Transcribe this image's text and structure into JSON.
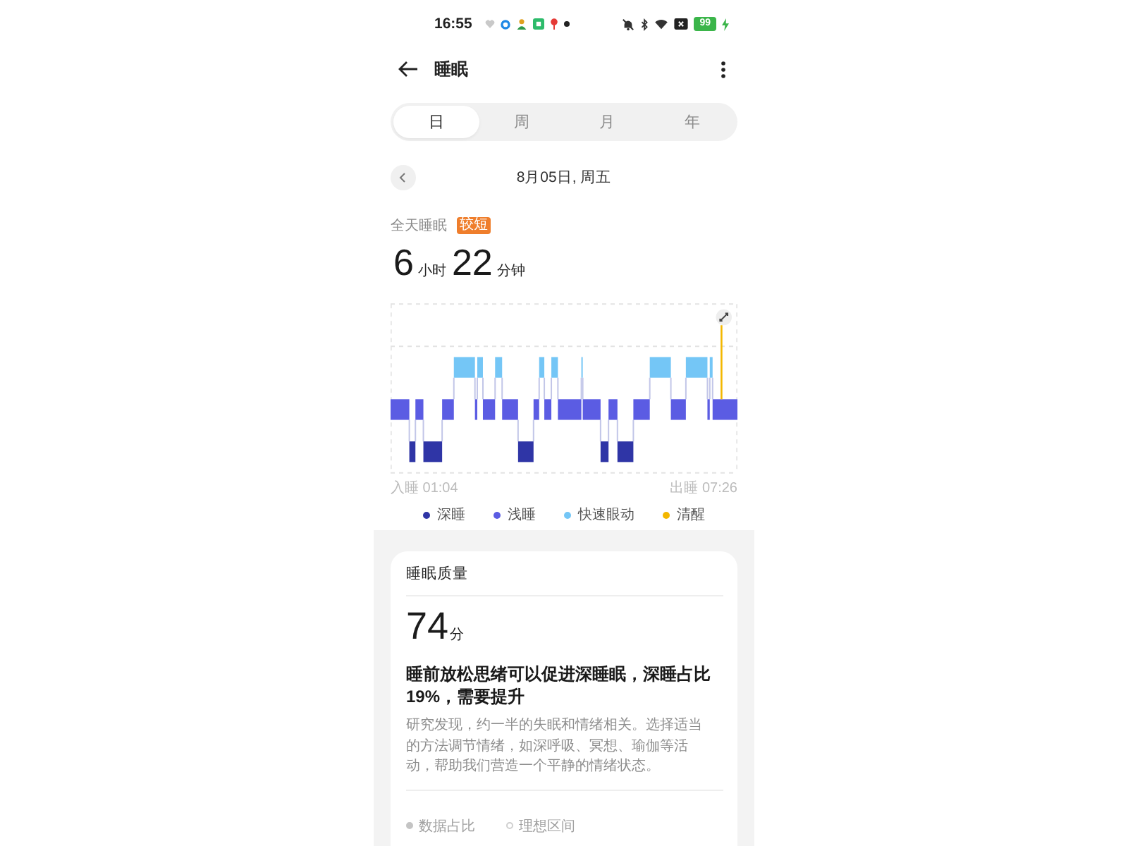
{
  "status_bar": {
    "time": "16:55",
    "battery": "99"
  },
  "header": {
    "title": "睡眠"
  },
  "period_tabs": [
    {
      "label": "日",
      "selected": true
    },
    {
      "label": "周",
      "selected": false
    },
    {
      "label": "月",
      "selected": false
    },
    {
      "label": "年",
      "selected": false
    }
  ],
  "date_nav": {
    "date": "8月05日, 周五"
  },
  "summary": {
    "label": "全天睡眠",
    "badge": "较短",
    "duration": [
      {
        "value": "6",
        "unit": "小时"
      },
      {
        "value": "22",
        "unit": "分钟"
      }
    ]
  },
  "chart": {
    "start_label": "入睡 01:04",
    "end_label": "出睡 07:26",
    "legend": [
      {
        "label": "深睡",
        "color": "#2f35a6"
      },
      {
        "label": "浅睡",
        "color": "#5b5ce3"
      },
      {
        "label": "快速眼动",
        "color": "#74c6f6"
      },
      {
        "label": "清醒",
        "color": "#f3b700"
      }
    ]
  },
  "quality_card": {
    "title": "睡眠质量",
    "score": "74",
    "score_unit": "分",
    "headline": "睡前放松思绪可以促进深睡眠，深睡占比19%，需要提升",
    "body": "研究发现，约一半的失眠和情绪相关。选择适当的方法调节情绪，如深呼吸、冥想、瑜伽等活动，帮助我们营造一个平静的情绪状态。",
    "legend": [
      {
        "label": "数据占比",
        "kind": "dot"
      },
      {
        "label": "理想区间",
        "kind": "ring"
      }
    ]
  }
}
